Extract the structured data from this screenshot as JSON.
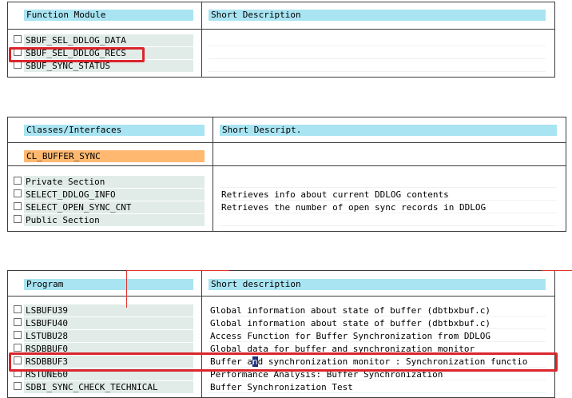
{
  "function_modules": {
    "col1": "Function Module",
    "col2": "Short Description",
    "rows": [
      {
        "name": "SBUF_SEL_DDLOG_DATA",
        "desc": ""
      },
      {
        "name": "SBUF_SEL_DDLOG_RECS",
        "desc": ""
      },
      {
        "name": "SBUF_SYNC_STATUS",
        "desc": ""
      }
    ]
  },
  "classes": {
    "col1": "Classes/Interfaces",
    "col2": "Short Descript.",
    "class_name": "CL_BUFFER_SYNC",
    "rows": [
      {
        "name": "Private Section",
        "desc": ""
      },
      {
        "name": "SELECT_DDLOG_INFO",
        "desc": "Retrieves info about current DDLOG contents"
      },
      {
        "name": "SELECT_OPEN_SYNC_CNT",
        "desc": "Retrieves the number of open sync records in DDLOG"
      },
      {
        "name": "Public Section",
        "desc": ""
      }
    ]
  },
  "programs": {
    "col1": "Program",
    "col2": "Short description",
    "rows": [
      {
        "name": "LSBUFU39",
        "desc": "Global information about state of buffer (dbtbxbuf.c)"
      },
      {
        "name": "LSBUFU40",
        "desc": "Global information about state of buffer (dbtbxbuf.c)"
      },
      {
        "name": "LSTUBU28",
        "desc": "Access Function for Buffer Synchronization from DDLOG"
      },
      {
        "name": "RSDBBUF0",
        "desc": "Global data for buffer and synchronization monitor"
      },
      {
        "name": "RSDBBUF3",
        "desc_pre": "Buffer a",
        "desc_sel": "n",
        "desc_post": "d synchronization monitor : Synchronization functio"
      },
      {
        "name": "RSTUNE60",
        "desc": "Performance Analysis: Buffer Synchronization"
      },
      {
        "name": "SDBI_SYNC_CHECK_TECHNICAL",
        "desc": "Buffer Synchronization Test"
      }
    ]
  },
  "colors": {
    "header_bg": "#a9e4f2",
    "name_cell_bg": "#e1ece9",
    "highlight_orange": "#ffb870",
    "annotation_red": "#d9262c"
  }
}
